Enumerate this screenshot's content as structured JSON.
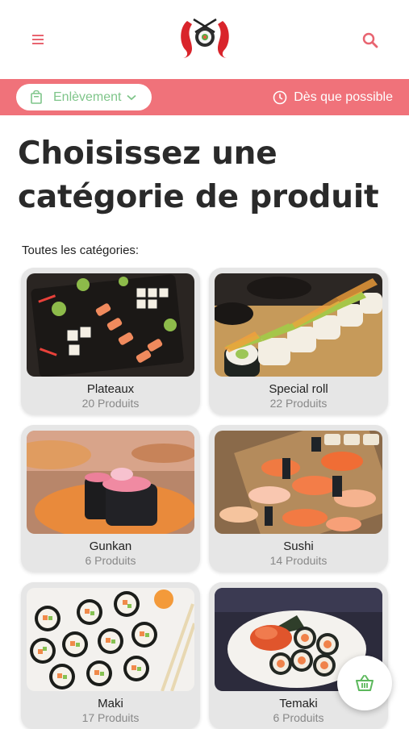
{
  "header": {
    "menu_icon": "hamburger-menu-icon",
    "search_icon": "search-icon",
    "logo": "koi-sushi-logo"
  },
  "order_bar": {
    "mode_label": "Enlèvement",
    "time_label": "Dès que possible",
    "accent_color": "#f0727a",
    "mode_color": "#7fc58a"
  },
  "main": {
    "title": "Choisissez une catégorie de produit",
    "section_label": "Toutes les catégories:"
  },
  "categories": [
    {
      "name": "Plateaux",
      "count": "20 Produits"
    },
    {
      "name": "Special roll",
      "count": "22 Produits"
    },
    {
      "name": "Gunkan",
      "count": "6 Produits"
    },
    {
      "name": "Sushi",
      "count": "14 Produits"
    },
    {
      "name": "Maki",
      "count": "17 Produits"
    },
    {
      "name": "Temaki",
      "count": "6 Produits"
    }
  ],
  "cart": {
    "icon": "basket-icon",
    "color": "#5cb85c"
  }
}
